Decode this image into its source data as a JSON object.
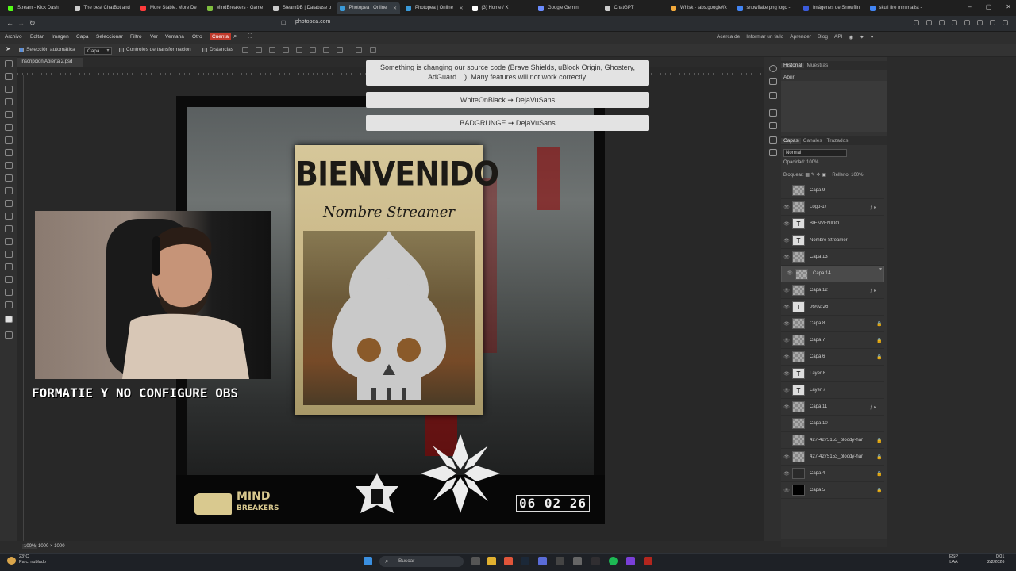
{
  "browser": {
    "tabs": [
      {
        "title": "Stream - Kick Dash",
        "color": "#53fc18"
      },
      {
        "title": "The best ChatBot and",
        "color": "#cccccc"
      },
      {
        "title": "More Stable. More De",
        "color": "#ff3b3b"
      },
      {
        "title": "MindBreakers - Game",
        "color": "#7fbf3f"
      },
      {
        "title": "SteamDB | Database o",
        "color": "#cccccc"
      },
      {
        "title": "Photopea | Online",
        "color": "#3a9ad9",
        "active": true
      },
      {
        "title": "Photopea | Online",
        "color": "#3a9ad9"
      },
      {
        "title": "(3) Home / X",
        "color": "#ffffff"
      },
      {
        "title": "Google Gemini",
        "color": "#6b8cff"
      },
      {
        "title": "ChatGPT",
        "color": "#cccccc"
      },
      {
        "title": "Whisk - labs.google/fx",
        "color": "#f2a93b"
      },
      {
        "title": "snowflake png logo -",
        "color": "#4285f4"
      },
      {
        "title": "Imágenes de Snowflin",
        "color": "#3b5bdb"
      },
      {
        "title": "skull fire minimalist -",
        "color": "#4285f4"
      }
    ],
    "url": "photopea.com"
  },
  "menu": {
    "items": [
      "Archivo",
      "Editar",
      "Imagen",
      "Capa",
      "Seleccionar",
      "Filtro",
      "Ver",
      "Ventana",
      "Otro"
    ],
    "account": "Cuenta",
    "right": [
      "Acerca de",
      "Informar un fallo",
      "Aprender",
      "Blog",
      "API"
    ]
  },
  "options": {
    "auto_select": "Selección automática",
    "auto_select_target": "Capa",
    "transform_controls": "Controles de transformación",
    "distances": "Distancias"
  },
  "document": {
    "tab_title": "Inscripcion Abierta 2.psd",
    "zoom": "100%",
    "size": "1000 × 1000"
  },
  "notices": {
    "warning": "Something is changing our source code (Brave Shields, uBlock Origin, Ghostery, AdGuard ...). Many features will not work correctly.",
    "font1": "WhiteOnBlack ➞ DejaVuSans",
    "font2": "BADGRUNGE ➞ DejaVuSans"
  },
  "artwork": {
    "title": "BIENVENIDO",
    "subtitle": "Nombre Streamer",
    "date": "06 02 26",
    "brand_line1": "MIND",
    "brand_line2": "BREAKERS"
  },
  "overlay": {
    "caption": "FORMATIE Y NO CONFIGURE OBS"
  },
  "panels": {
    "history_tabs": [
      "Historial",
      "Muestras"
    ],
    "history_item": "Abrir",
    "layer_tabs": [
      "Capas",
      "Canales",
      "Trazados"
    ],
    "blend_mode": "Normal",
    "opacity_label": "Opacidad:",
    "opacity_value": "100%",
    "lock_label": "Bloquear:",
    "fill_label": "Relleno:",
    "fill_value": "100%",
    "layers": [
      {
        "name": "Capa 9",
        "kind": "img",
        "visible": false
      },
      {
        "name": "Logo-17",
        "kind": "img",
        "fx": true,
        "visible": true
      },
      {
        "name": "BIENVENIDO",
        "kind": "text",
        "visible": true
      },
      {
        "name": "Nombre Streamer",
        "kind": "text",
        "visible": true
      },
      {
        "name": "Capa 13",
        "kind": "img",
        "visible": true
      },
      {
        "name": "Capa 14",
        "kind": "img",
        "selected": true,
        "visible": true
      },
      {
        "name": "Capa 12",
        "kind": "img",
        "fx": true,
        "visible": true
      },
      {
        "name": "06/02/26",
        "kind": "text",
        "visible": true
      },
      {
        "name": "Capa 8",
        "kind": "img",
        "locked": true,
        "visible": true
      },
      {
        "name": "Capa 7",
        "kind": "img",
        "locked": true,
        "visible": true
      },
      {
        "name": "Capa 6",
        "kind": "img",
        "locked": true,
        "visible": true
      },
      {
        "name": "Layer 8",
        "kind": "text",
        "visible": true
      },
      {
        "name": "Layer 7",
        "kind": "text",
        "visible": true
      },
      {
        "name": "Capa 11",
        "kind": "img",
        "fx": true,
        "visible": true
      },
      {
        "name": "Capa 10",
        "kind": "img",
        "visible": false
      },
      {
        "name": "427-4275153_bloody-har",
        "kind": "img",
        "locked": true,
        "visible": false
      },
      {
        "name": "427-4275153_bloody-har",
        "kind": "img",
        "locked": true,
        "visible": true
      },
      {
        "name": "Capa 4",
        "kind": "dark",
        "locked": true,
        "visible": true
      },
      {
        "name": "Capa 5",
        "kind": "black",
        "locked": true,
        "visible": true
      }
    ]
  },
  "taskbar": {
    "weather_temp": "23°C",
    "weather_desc": "Parc. nublado",
    "search": "Buscar",
    "lang1": "ESP",
    "lang2": "LAA",
    "time": "0:01",
    "date": "2/2/2026"
  }
}
